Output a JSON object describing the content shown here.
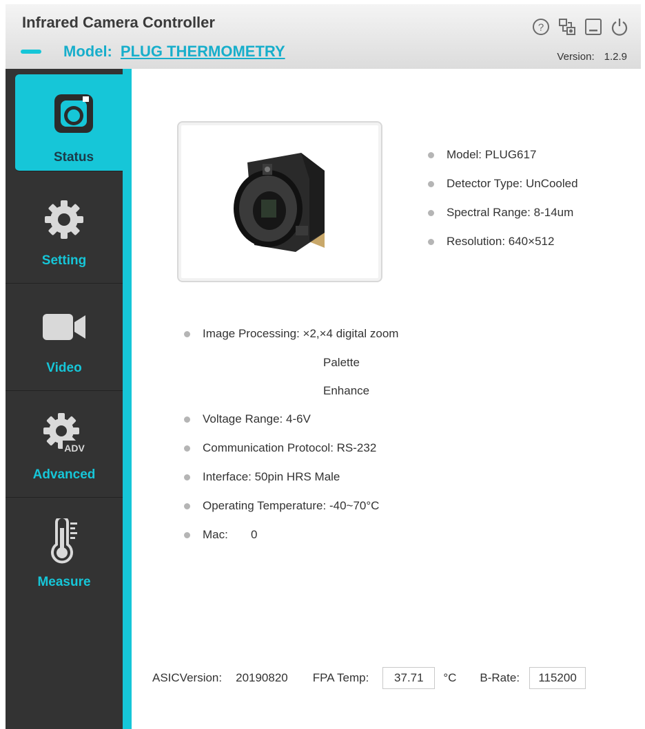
{
  "header": {
    "title": "Infrared Camera Controller",
    "model_label": "Model:",
    "model_value": "PLUG THERMOMETRY",
    "version_label": "Version:",
    "version_value": "1.2.9",
    "icons": [
      "help-icon",
      "connection-icon",
      "minimize-icon",
      "power-icon"
    ]
  },
  "sidebar": {
    "items": [
      {
        "label": "Status",
        "icon": "camera-icon",
        "active": true
      },
      {
        "label": "Setting",
        "icon": "gear-icon",
        "active": false
      },
      {
        "label": "Video",
        "icon": "video-camera-icon",
        "active": false
      },
      {
        "label": "Advanced",
        "icon": "advanced-gear-icon",
        "active": false
      },
      {
        "label": "Measure",
        "icon": "thermometer-icon",
        "active": false
      }
    ]
  },
  "status": {
    "model": "Model: PLUG617",
    "detector_type": "Detector Type: UnCooled",
    "spectral_range": "Spectral Range: 8-14um",
    "resolution": "Resolution:  640×512",
    "image_processing": "Image Processing: ×2,×4 digital zoom",
    "image_processing_2": "Palette",
    "image_processing_3": "Enhance",
    "voltage_range": "Voltage Range: 4-6V",
    "communication_protocol": "Communication Protocol: RS-232",
    "interface": "Interface: 50pin HRS Male",
    "operating_temperature": "Operating Temperature: -40~70°C",
    "mac_label": "Mac:",
    "mac_value": "0"
  },
  "footer": {
    "asic_label": "ASICVersion:",
    "asic_value": "20190820",
    "fpa_label": "FPA Temp:",
    "fpa_value": "37.71",
    "fpa_unit": "°C",
    "brate_label": "B-Rate:",
    "brate_value": "115200"
  },
  "colors": {
    "accent": "#16c6d8",
    "sidebar_bg": "#333333",
    "header_bg": "#e6e6e6"
  }
}
